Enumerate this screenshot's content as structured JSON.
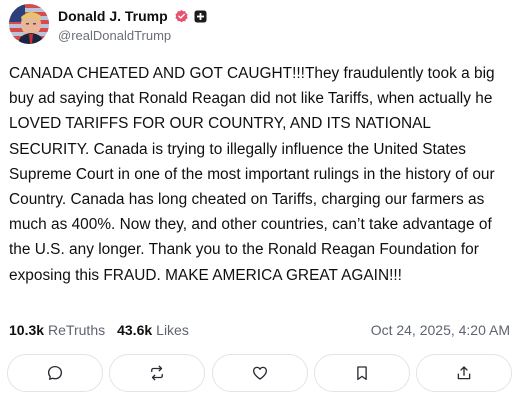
{
  "author": {
    "display_name": "Donald J. Trump",
    "handle": "@realDonaldTrump",
    "avatar_icon": "profile-photo",
    "verified_icon": "verified-badge-icon",
    "tag_icon": "plus-square-icon",
    "verified_color": "#e8506e"
  },
  "post": {
    "text": "CANADA CHEATED AND GOT CAUGHT!!!They fraudulently took a big buy ad saying that Ronald Reagan did not like Tariffs, when actually he LOVED TARIFFS FOR OUR COUNTRY, AND ITS NATIONAL SECURITY. Canada is trying to illegally influence the United States Supreme Court in one of the most important rulings in the history of our Country. Canada has long cheated on Tariffs, charging our farmers as much as 400%. Now they, and other countries, can’t take advantage of the U.S. any longer. Thank you to the Ronald Reagan Foundation for exposing this FRAUD. MAKE AMERICA GREAT AGAIN!!!"
  },
  "stats": {
    "retruths_count": "10.3k",
    "retruths_label": "ReTruths",
    "likes_count": "43.6k",
    "likes_label": "Likes",
    "timestamp": "Oct 24, 2025, 4:20 AM"
  },
  "actions": [
    {
      "name": "reply",
      "icon": "comment-icon"
    },
    {
      "name": "retruth",
      "icon": "repost-icon"
    },
    {
      "name": "like",
      "icon": "heart-icon"
    },
    {
      "name": "bookmark",
      "icon": "bookmark-icon"
    },
    {
      "name": "share",
      "icon": "share-icon"
    }
  ]
}
